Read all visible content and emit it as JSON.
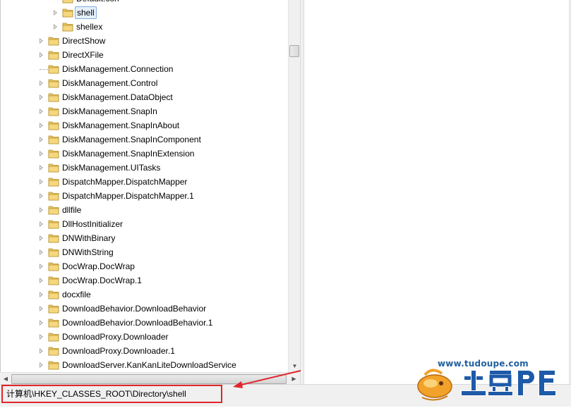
{
  "tree": {
    "items": [
      {
        "label": "Default.con",
        "level": 2,
        "expander": "none"
      },
      {
        "label": "shell",
        "level": 2,
        "expander": "collapsed",
        "selected": true
      },
      {
        "label": "shellex",
        "level": 2,
        "expander": "collapsed"
      },
      {
        "label": "DirectShow",
        "level": 1,
        "expander": "collapsed"
      },
      {
        "label": "DirectXFile",
        "level": 1,
        "expander": "collapsed"
      },
      {
        "label": "DiskManagement.Connection",
        "level": 1,
        "expander": "none"
      },
      {
        "label": "DiskManagement.Control",
        "level": 1,
        "expander": "collapsed"
      },
      {
        "label": "DiskManagement.DataObject",
        "level": 1,
        "expander": "collapsed"
      },
      {
        "label": "DiskManagement.SnapIn",
        "level": 1,
        "expander": "collapsed"
      },
      {
        "label": "DiskManagement.SnapInAbout",
        "level": 1,
        "expander": "collapsed"
      },
      {
        "label": "DiskManagement.SnapInComponent",
        "level": 1,
        "expander": "collapsed"
      },
      {
        "label": "DiskManagement.SnapInExtension",
        "level": 1,
        "expander": "collapsed"
      },
      {
        "label": "DiskManagement.UITasks",
        "level": 1,
        "expander": "collapsed"
      },
      {
        "label": "DispatchMapper.DispatchMapper",
        "level": 1,
        "expander": "collapsed"
      },
      {
        "label": "DispatchMapper.DispatchMapper.1",
        "level": 1,
        "expander": "collapsed"
      },
      {
        "label": "dllfile",
        "level": 1,
        "expander": "collapsed"
      },
      {
        "label": "DllHostInitializer",
        "level": 1,
        "expander": "collapsed"
      },
      {
        "label": "DNWithBinary",
        "level": 1,
        "expander": "collapsed"
      },
      {
        "label": "DNWithString",
        "level": 1,
        "expander": "collapsed"
      },
      {
        "label": "DocWrap.DocWrap",
        "level": 1,
        "expander": "collapsed"
      },
      {
        "label": "DocWrap.DocWrap.1",
        "level": 1,
        "expander": "collapsed"
      },
      {
        "label": "docxfile",
        "level": 1,
        "expander": "collapsed"
      },
      {
        "label": "DownloadBehavior.DownloadBehavior",
        "level": 1,
        "expander": "collapsed"
      },
      {
        "label": "DownloadBehavior.DownloadBehavior.1",
        "level": 1,
        "expander": "collapsed"
      },
      {
        "label": "DownloadProxy.Downloader",
        "level": 1,
        "expander": "collapsed"
      },
      {
        "label": "DownloadProxy.Downloader.1",
        "level": 1,
        "expander": "collapsed"
      },
      {
        "label": "DownloadServer.KanKanLiteDownloadService",
        "level": 1,
        "expander": "collapsed"
      }
    ]
  },
  "statusbar": {
    "path": "计算机\\HKEY_CLASSES_ROOT\\Directory\\shell"
  },
  "watermark": {
    "url": "www.tudoupe.com",
    "brand": "土豆PE"
  },
  "colors": {
    "highlight_border": "#e0262c",
    "selection_bg": "#e5f0fb",
    "folder": "#e8c35a"
  },
  "icons": {
    "folder": "folder-icon",
    "expander": "expand-arrow-icon",
    "scroll_down": "scroll-down-arrow-icon",
    "scroll_left": "scroll-left-arrow-icon",
    "scroll_right": "scroll-right-arrow-icon"
  }
}
